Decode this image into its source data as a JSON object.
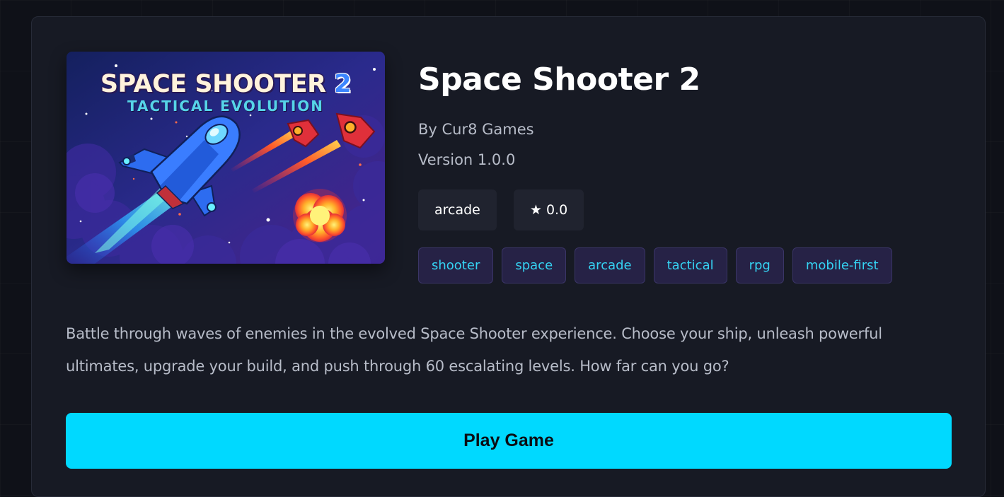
{
  "game": {
    "cover": {
      "title_main": "SPACE SHOOTER",
      "title_number": "2",
      "subtitle": "TACTICAL EVOLUTION"
    },
    "title": "Space Shooter 2",
    "author": "By Cur8 Games",
    "version": "Version 1.0.0",
    "category": "arcade",
    "rating": "★ 0.0",
    "tags": [
      "shooter",
      "space",
      "arcade",
      "tactical",
      "rpg",
      "mobile-first"
    ],
    "description": "Battle through waves of enemies in the evolved Space Shooter experience. Choose your ship, unleash powerful ultimates, upgrade your build, and push through 60 escalating levels. How far can you go?",
    "play_label": "Play Game"
  },
  "colors": {
    "page_background": "#0f1118",
    "card_background": "#171a24",
    "accent": "#00d9ff",
    "tag_text": "#35d3f3",
    "tag_background": "#262246"
  }
}
